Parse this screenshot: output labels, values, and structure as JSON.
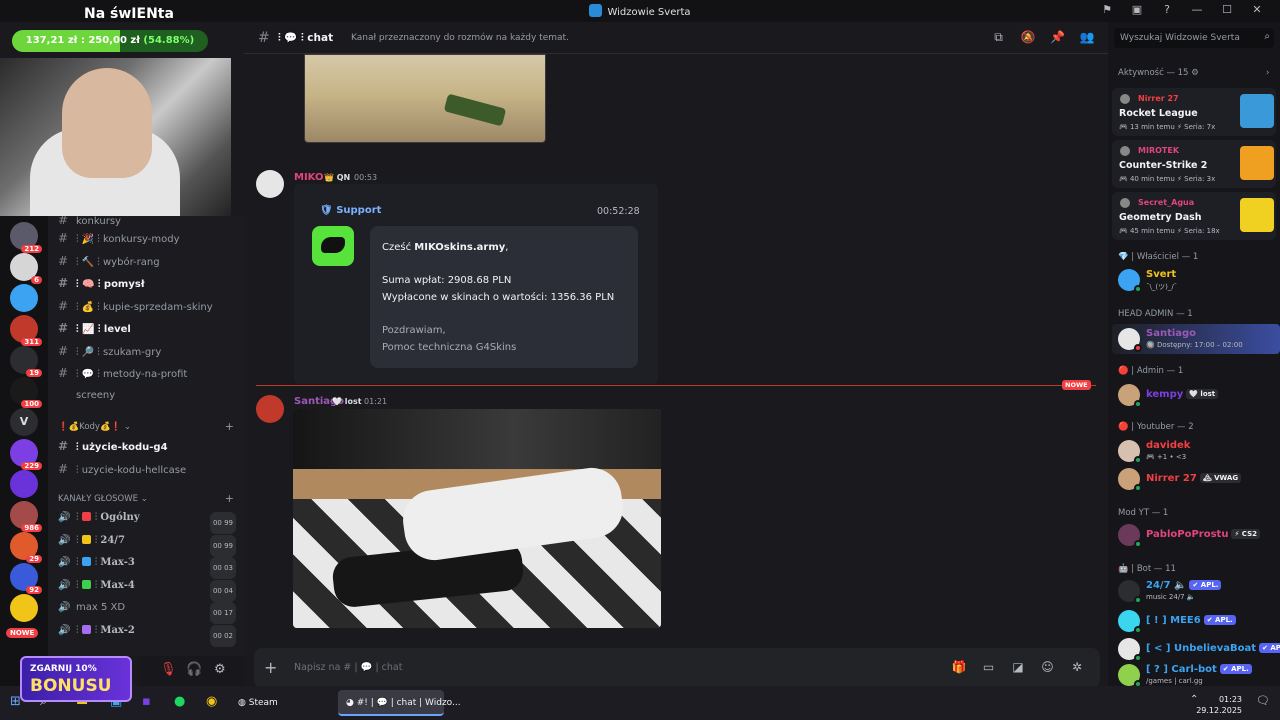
{
  "window": {
    "title": "Widzowie Sverta"
  },
  "stream": {
    "title": "Na śwIENta",
    "goal_text": "137,21 zł : 250,00 zł",
    "goal_pct_text": "(54.88%)",
    "goal_progress": 0.5488
  },
  "servers": [
    {
      "badge": "212"
    },
    {
      "badge": "6"
    },
    {
      "badge": ""
    },
    {
      "badge": "311"
    },
    {
      "badge": "19"
    },
    {
      "badge": "100"
    },
    {
      "label": "V",
      "badge": ""
    },
    {
      "badge": "229"
    },
    {
      "badge": ""
    },
    {
      "badge": "986"
    },
    {
      "badge": "29"
    },
    {
      "badge": "92"
    },
    {
      "badge": ""
    }
  ],
  "servers_new": "NOWE",
  "channels": {
    "text": [
      {
        "name": "konkursy",
        "bold": false
      },
      {
        "name": "konkursy-mody",
        "bold": false
      },
      {
        "name": "wybór-rang",
        "bold": false
      },
      {
        "name": "pomysł",
        "bold": true
      },
      {
        "name": "kupie-sprzedam-skiny",
        "bold": false
      },
      {
        "name": "level",
        "bold": true
      },
      {
        "name": "szukam-gry",
        "bold": false
      },
      {
        "name": "metody-na-profit",
        "bold": false
      },
      {
        "name": "screeny",
        "bold": false
      }
    ],
    "codes_category": "Kody",
    "codes": [
      {
        "name": "użycie-kodu-g4",
        "bold": true
      },
      {
        "name": "uzycie-kodu-hellcase",
        "bold": false
      }
    ],
    "voice_category": "KANAŁY GŁOSOWE",
    "voice": [
      {
        "name": "Ogólny",
        "count": "00 99",
        "color": "#f23f43"
      },
      {
        "name": "24/7",
        "count": "00 99",
        "color": "#f0c419"
      },
      {
        "name": "Max-3",
        "count": "00 03",
        "color": "#3ba3f2"
      },
      {
        "name": "Max-4",
        "count": "00 04",
        "color": "#3bd14c"
      },
      {
        "name": "max 5 XD",
        "count": "00 17",
        "color": ""
      },
      {
        "name": "Max-2",
        "count": "00 02",
        "color": "#a56ef2"
      }
    ]
  },
  "bonus": {
    "line1": "ZGARNIJ 10%",
    "line2": "BONUSU"
  },
  "header": {
    "channel": "chat",
    "topic": "Kanał przeznaczony do rozmów na każdy temat."
  },
  "messages": {
    "miko": {
      "author": "MIKO",
      "role": "👑 QN",
      "time": "00:53"
    },
    "embed": {
      "header": "Support",
      "time": "00:52:28",
      "greeting_prefix": "Cześć ",
      "greeting_name": "MIKOskins.army",
      "greeting_suffix": ",",
      "line_deposits": "Suma wpłat: 2908.68 PLN",
      "line_withdraw": "Wypłacone w skinach o wartości: 1356.36 PLN",
      "sign1": "Pozdrawiam,",
      "sign2": "Pomoc techniczna G4Skins"
    },
    "new_tag": "NOWE",
    "santiago": {
      "author": "Santiago",
      "role": "🤍 lost",
      "time": "01:21"
    }
  },
  "composer": {
    "placeholder": "Napisz na # | 💬 | chat"
  },
  "search": {
    "placeholder": "Wyszukaj Widzowie Sverta"
  },
  "members": {
    "activity_title": "Aktywność — 15",
    "activities": [
      {
        "who": "Nirrer 27",
        "color": "#f23f43",
        "game": "Rocket League",
        "meta": "🎮 13 min temu  ⚡ Seria: 7x",
        "icon": "#3a9ad9"
      },
      {
        "who": "MIROTEK",
        "color": "#e0457b",
        "game": "Counter-Strike 2",
        "meta": "🎮 40 min temu  ⚡ Seria: 3x",
        "icon": "#f0a020"
      },
      {
        "who": "Secret_Agua",
        "color": "#e0457b",
        "game": "Geometry Dash",
        "meta": "🎮 45 min temu  ⚡ Seria: 18x",
        "icon": "#f0d020"
      }
    ],
    "groups": [
      {
        "title": "💎 | Właściciel — 1",
        "members": [
          {
            "name": "Svert",
            "color": "#f0c419",
            "sub": "¯\\_(ツ)_/¯",
            "tag": ""
          }
        ]
      },
      {
        "title": "HEAD ADMIN — 1",
        "members": [
          {
            "name": "Santiago",
            "color": "#9b59b6",
            "sub": "🔘 Dostępny: 17:00 – 02:00",
            "tag": ""
          }
        ]
      },
      {
        "title": "🔴 | Admin — 1",
        "members": [
          {
            "name": "kempy",
            "color": "#7b3fe4",
            "sub": "",
            "tag": "🤍 lost"
          }
        ]
      },
      {
        "title": "🔴 | Youtuber — 2",
        "members": [
          {
            "name": "davidek",
            "color": "#f23f43",
            "sub": "🎮 +1 • <3",
            "tag": ""
          },
          {
            "name": "Nirrer 27",
            "color": "#f23f43",
            "sub": "",
            "tag": "🏔 VWAG"
          }
        ]
      },
      {
        "title": "Mod YT — 1",
        "members": [
          {
            "name": "PabloPoProstu",
            "color": "#e0457b",
            "sub": "",
            "tag": "⚡ CS2"
          }
        ]
      },
      {
        "title": "🤖 | Bot — 11",
        "members": [
          {
            "name": "24/7 🔈",
            "color": "#3ba3f2",
            "sub": "music 24/7 🔈",
            "tag": "✔ APL."
          },
          {
            "name": "[ ! ] MEE6",
            "color": "#3ba3f2",
            "sub": "",
            "tag": "✔ APL."
          },
          {
            "name": "[ < ] UnbelievaBoat",
            "color": "#3ba3f2",
            "sub": "",
            "tag": "✔ APL."
          },
          {
            "name": "[ ? ] Carl-bot",
            "color": "#3ba3f2",
            "sub": "/games | carl.gg",
            "tag": "✔ APL."
          }
        ]
      }
    ]
  },
  "taskbar": {
    "steam": "Steam",
    "discord": "#! | 💬 | chat | Widzo...",
    "time": "01:23",
    "date": "29.12.2025"
  }
}
